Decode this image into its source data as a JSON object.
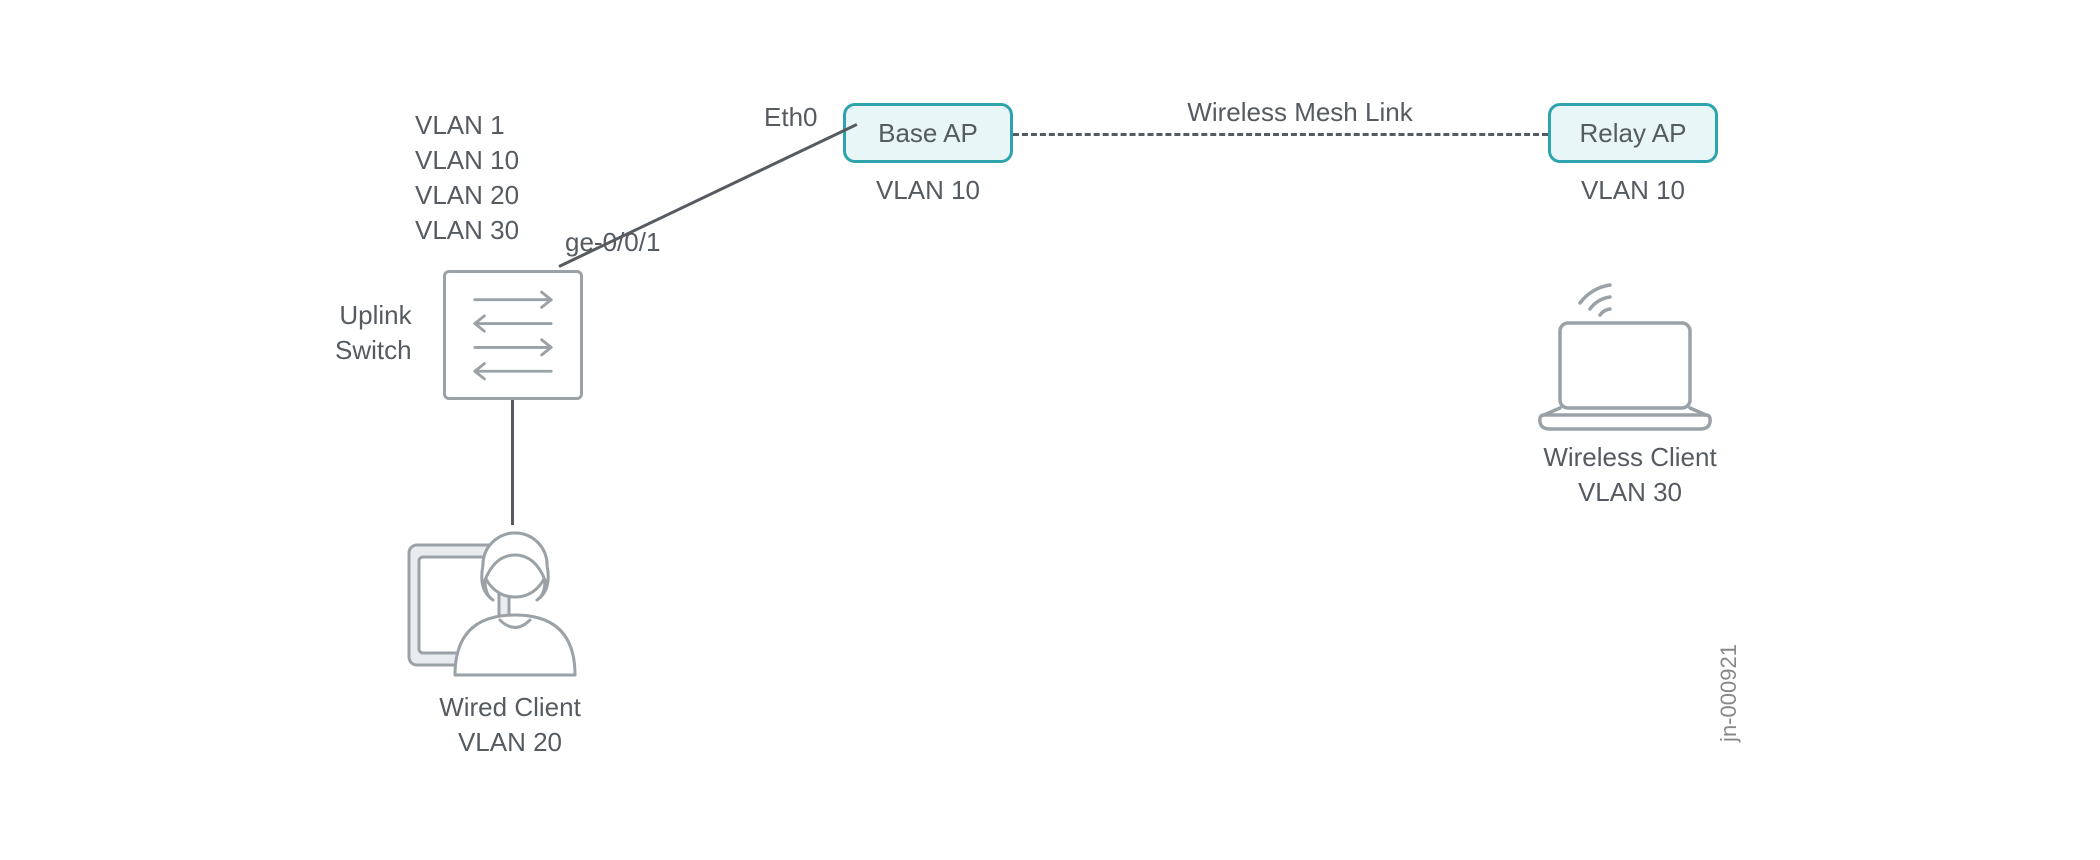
{
  "labels": {
    "eth0": "Eth0",
    "vlans_block": "VLAN 1\nVLAN 10\nVLAN 20\nVLAN 30",
    "ge_port": "ge-0/0/1",
    "uplink_switch": "Uplink\nSwitch",
    "base_ap": "Base AP",
    "base_ap_vlan": "VLAN 10",
    "mesh_link": "Wireless Mesh Link",
    "relay_ap": "Relay AP",
    "relay_ap_vlan": "VLAN 10",
    "wireless_client": "Wireless Client\nVLAN 30",
    "wired_client": "Wired Client\nVLAN 20",
    "diagram_id": "jn-000921"
  }
}
